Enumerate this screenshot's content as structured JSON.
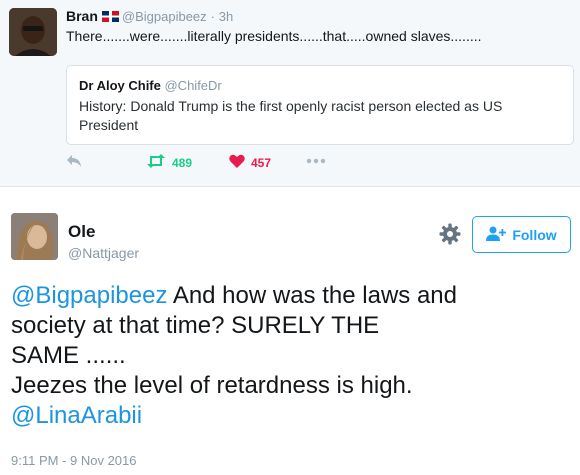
{
  "top_tweet": {
    "author_name": "Bran",
    "author_handle": "@Bigpapibeez",
    "time_sep": "·",
    "time": "3h",
    "text": "There.......were.......literally presidents......that.....owned slaves........",
    "quoted": {
      "author_name": "Dr Aloy Chife",
      "author_handle": "@ChifeDr",
      "text": "History: Donald Trump is the first openly racist person elected as US President"
    },
    "retweet_count": "489",
    "like_count": "457",
    "icons": [
      "reply-icon",
      "retweet-icon",
      "heart-icon",
      "more-icon",
      "flag-icon"
    ]
  },
  "main_tweet": {
    "author_name": "Ole",
    "author_handle": "@Nattjager",
    "follow_label": "Follow",
    "text_line1_mention": "@Bigpapibeez",
    "text_line1_rest": " And how was the laws and",
    "text_line2": "society at that time? SURELY THE",
    "text_line3": "SAME ......",
    "text_line4": "Jeezes the level of retardness is high.",
    "text_line5_mention": "@LinaArabii",
    "timestamp": "9:11 PM - 9 Nov 2016",
    "icons": [
      "gear-icon",
      "follow-person-icon"
    ]
  },
  "colors": {
    "link_blue": "#1b95e0",
    "retweet_green": "#19cf86",
    "like_red": "#e81c4f",
    "muted_gray": "#8899a6"
  }
}
